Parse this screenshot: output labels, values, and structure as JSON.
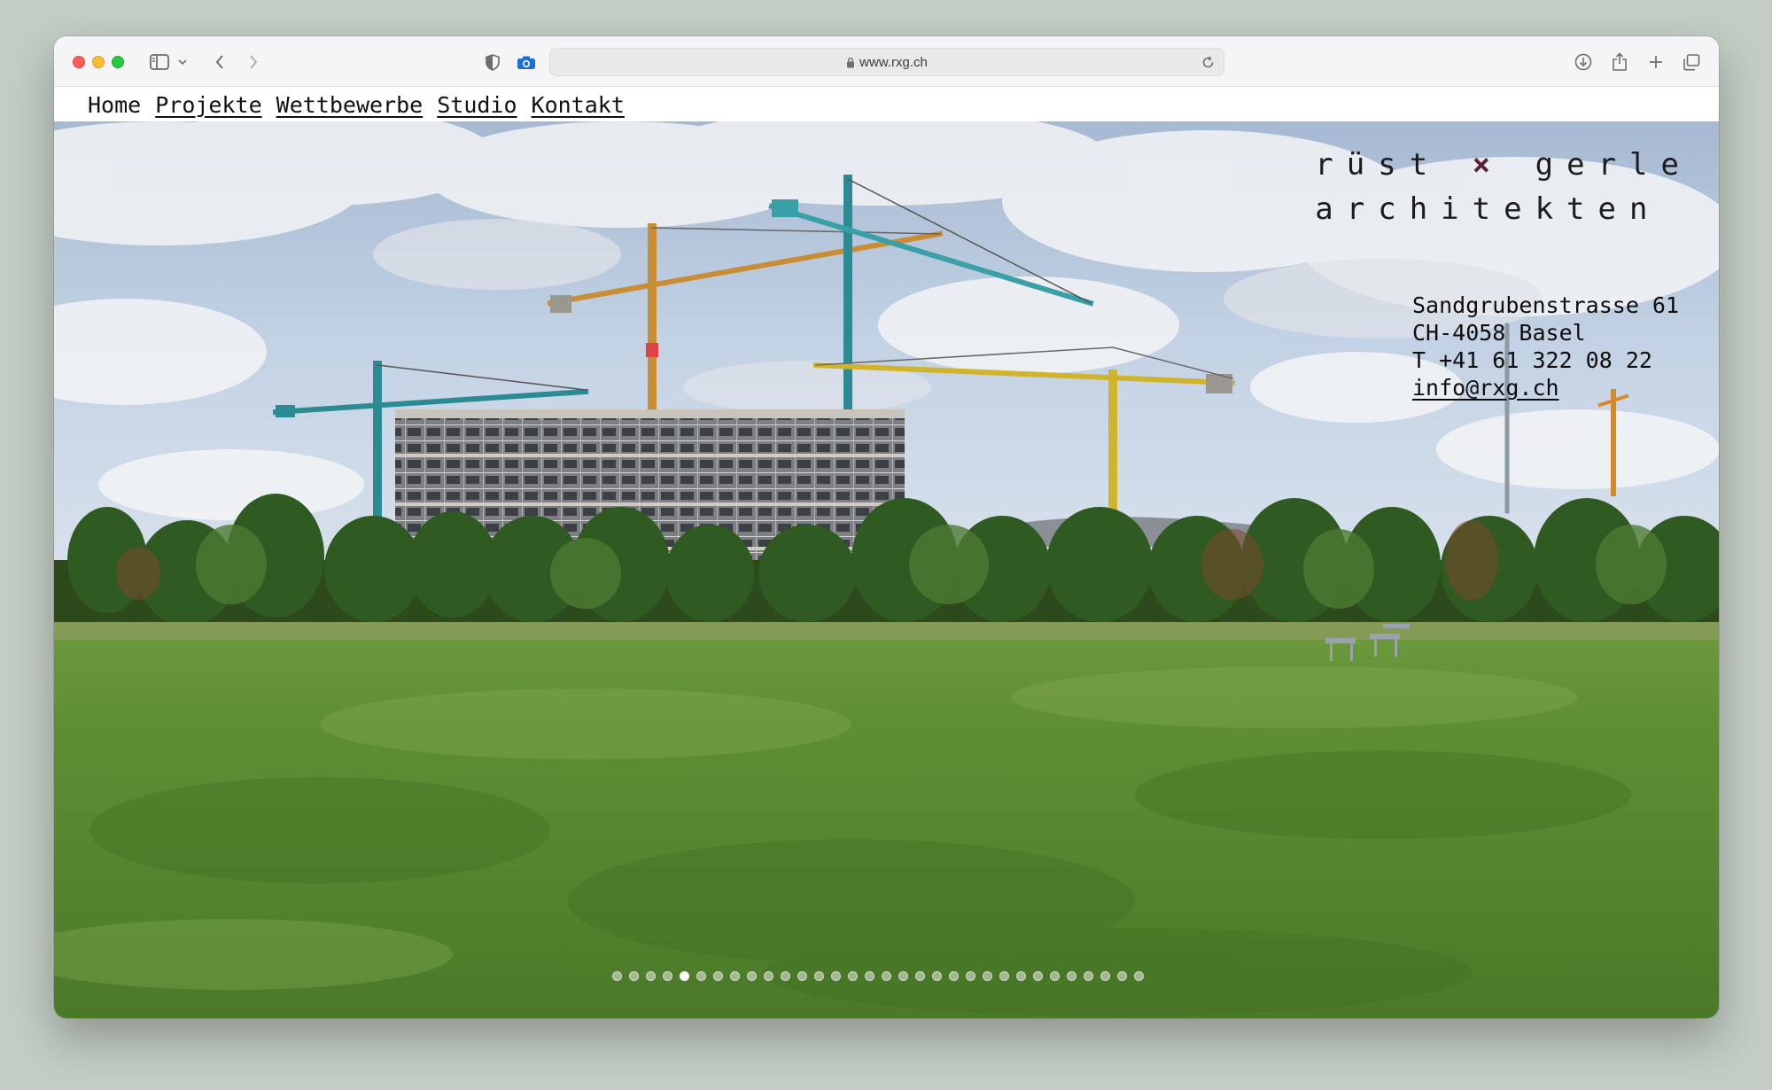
{
  "browser": {
    "url": "www.rxg.ch"
  },
  "nav": {
    "items": [
      "Home",
      "Projekte",
      "Wettbewerbe",
      "Studio",
      "Kontakt"
    ]
  },
  "brand": {
    "line1_left": "rüst",
    "line1_right": "gerle",
    "line2": "architekten",
    "accent": "#5b2331"
  },
  "contact": {
    "street": "Sandgrubenstrasse 61",
    "city": "CH-4058 Basel",
    "phone": "T +41 61 322 08 22",
    "email": "info@rxg.ch"
  },
  "slideshow": {
    "total": 32,
    "active_index": 4
  },
  "icons": [
    "sidebar-icon",
    "chevron-down-icon",
    "back-icon",
    "forward-icon",
    "shield-icon",
    "camera-icon",
    "lock-icon",
    "reload-icon",
    "download-icon",
    "share-icon",
    "new-tab-icon",
    "tabs-overview-icon"
  ]
}
